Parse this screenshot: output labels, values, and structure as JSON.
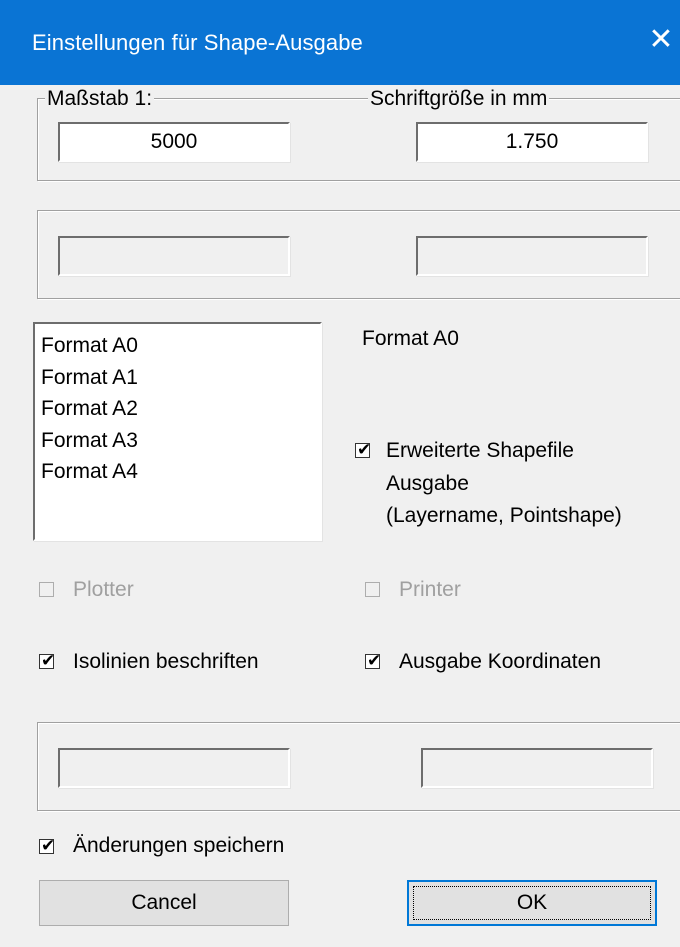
{
  "window": {
    "title": "Einstellungen für Shape-Ausgabe",
    "close_glyph": "✕"
  },
  "scale_group": {
    "scale_label": "Maßstab 1:",
    "scale_value": "5000",
    "font_label": "Schriftgröße in mm",
    "font_value": "1.750"
  },
  "format": {
    "items": [
      "Format A0",
      "Format A1",
      "Format A2",
      "Format A3",
      "Format A4"
    ],
    "selected_label": "Format A0"
  },
  "options": {
    "extended_shapefile": {
      "line1": "Erweiterte Shapefile",
      "line2": "Ausgabe",
      "line3": "(Layername, Pointshape)",
      "checked": true
    },
    "plotter": {
      "label": "Plotter",
      "checked": false,
      "enabled": false
    },
    "printer": {
      "label": "Printer",
      "checked": false,
      "enabled": false
    },
    "isolines": {
      "label": "Isolinien beschriften",
      "checked": true
    },
    "coordinates": {
      "label": "Ausgabe Koordinaten",
      "checked": true
    },
    "save_changes": {
      "label": "Änderungen speichern",
      "checked": true
    }
  },
  "check_glyph": "✔",
  "buttons": {
    "cancel": "Cancel",
    "ok": "OK"
  },
  "colors": {
    "titlebar": "#0a74d4",
    "accent": "#0078d7",
    "disabled_text": "#a0a0a0"
  }
}
